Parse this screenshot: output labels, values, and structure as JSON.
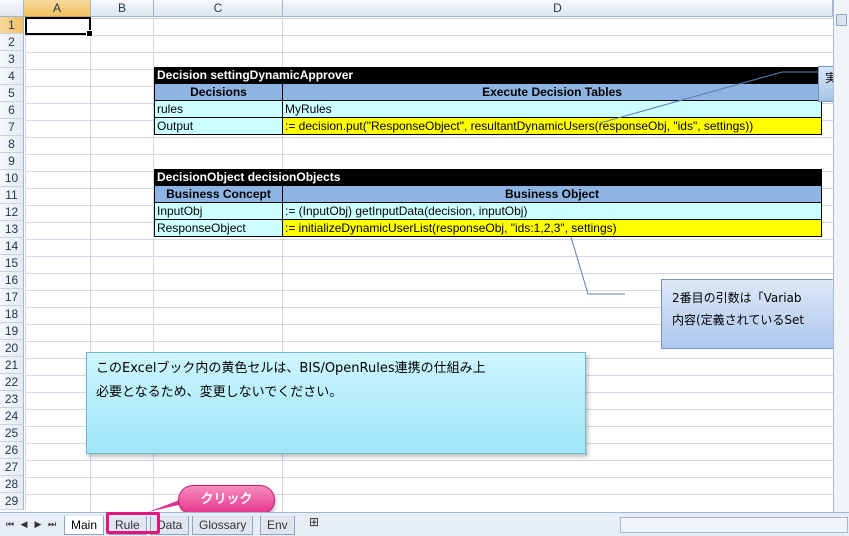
{
  "columns": [
    "A",
    "B",
    "C",
    "D"
  ],
  "rows": [
    "1",
    "2",
    "3",
    "4",
    "5",
    "6",
    "7",
    "8",
    "9",
    "10",
    "11",
    "12",
    "13",
    "14",
    "15",
    "16",
    "17",
    "18",
    "19",
    "20",
    "21",
    "22",
    "23",
    "24",
    "25",
    "26",
    "27",
    "28",
    "29"
  ],
  "decision_table": {
    "title": "Decision settingDynamicApprover",
    "header_left": "Decisions",
    "header_right": "Execute Decision Tables",
    "rows": [
      {
        "name": "rules",
        "value": "MyRules"
      },
      {
        "name": "Output",
        "value": ":= decision.put(\"ResponseObject\", resultantDynamicUsers(responseObj, \"ids\", settings))"
      }
    ]
  },
  "objects_table": {
    "title": "DecisionObject decisionObjects",
    "header_left": "Business Concept",
    "header_right": "Business Object",
    "rows": [
      {
        "name": "InputObj",
        "value": ":= (InputObj) getInputData(decision, inputObj)"
      },
      {
        "name": "ResponseObject",
        "value": ":= initializeDynamicUserList(responseObj, \"ids:1,2,3\", settings)"
      }
    ]
  },
  "callouts": {
    "top_right_text": "実",
    "right_line1": "2番目の引数は「Variab",
    "right_line2": "内容(定義されているSet",
    "main_line1": "このExcelブック内の黄色セルは、BIS/OpenRules連携の仕組み上",
    "main_line2": "必要となるため、変更しないでください。",
    "click_label": "クリック"
  },
  "tabs": [
    "Main",
    "Rule",
    "Data",
    "Glossary",
    "Env"
  ],
  "active_tab": "Main",
  "colors": {
    "header_blue": "#8eb4e3",
    "row_cyan": "#ccffff",
    "row_yellow": "#ffff00",
    "click_pink": "#e5338c"
  }
}
